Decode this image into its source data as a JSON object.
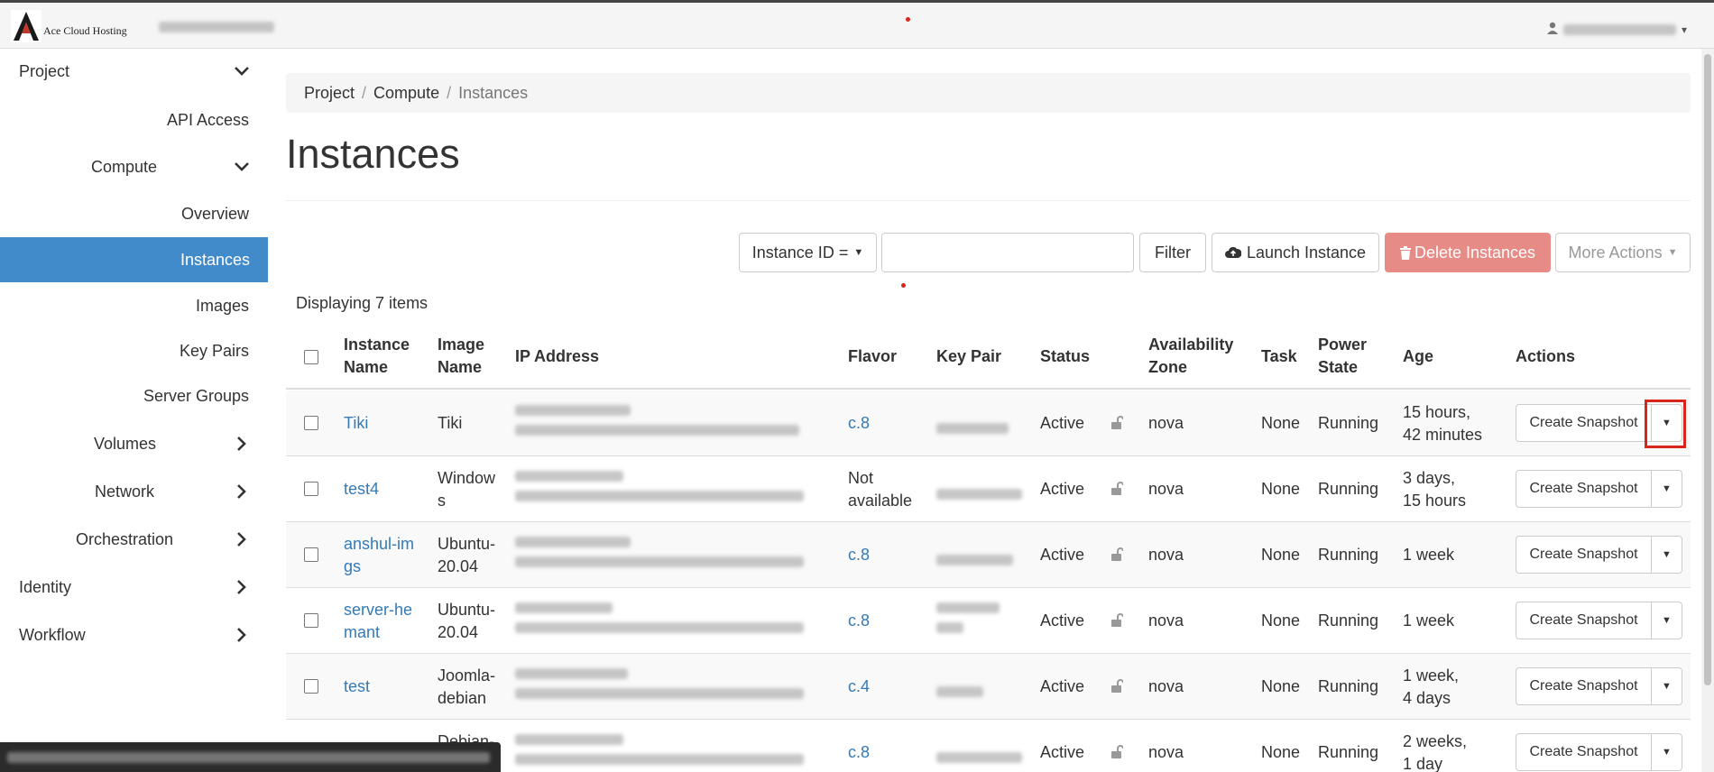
{
  "brand": {
    "name": "Ace Cloud Hosting"
  },
  "sidebar": {
    "items": [
      {
        "label": "Project",
        "chevron": "down"
      },
      {
        "label": "API Access"
      },
      {
        "label": "Compute",
        "chevron": "down"
      },
      {
        "label": "Overview"
      },
      {
        "label": "Instances",
        "active": true
      },
      {
        "label": "Images"
      },
      {
        "label": "Key Pairs"
      },
      {
        "label": "Server Groups"
      },
      {
        "label": "Volumes",
        "chevron": "right"
      },
      {
        "label": "Network",
        "chevron": "right"
      },
      {
        "label": "Orchestration",
        "chevron": "right"
      },
      {
        "label": "Identity",
        "chevron": "right"
      },
      {
        "label": "Workflow",
        "chevron": "right"
      }
    ]
  },
  "breadcrumb": {
    "items": [
      "Project",
      "Compute",
      "Instances"
    ]
  },
  "page": {
    "title": "Instances"
  },
  "toolbar": {
    "filter_field": "Instance ID =",
    "search_placeholder": "",
    "filter_label": "Filter",
    "launch_label": "Launch Instance",
    "delete_label": "Delete Instances",
    "more_label": "More Actions"
  },
  "table": {
    "count_text": "Displaying 7 items",
    "headers": {
      "name": [
        "Instance",
        "Name"
      ],
      "image": [
        "Image",
        "Name"
      ],
      "ip": "IP Address",
      "flavor": "Flavor",
      "keypair": "Key Pair",
      "status": "Status",
      "az": [
        "Availability",
        "Zone"
      ],
      "task": "Task",
      "power": [
        "Power",
        "State"
      ],
      "age": "Age",
      "actions": "Actions"
    },
    "rows": [
      {
        "name": [
          "Tiki"
        ],
        "image": [
          "Tiki"
        ],
        "flavor": [
          "c.8"
        ],
        "flavor_link": true,
        "status": "Active",
        "az": "nova",
        "task": "None",
        "power": "Running",
        "age": [
          "15 hours,",
          "42 minutes"
        ],
        "action": "Create Snapshot"
      },
      {
        "name": [
          "test4"
        ],
        "image": [
          "Window",
          "s"
        ],
        "flavor": [
          "Not",
          "available"
        ],
        "flavor_link": false,
        "status": "Active",
        "az": "nova",
        "task": "None",
        "power": "Running",
        "age": [
          "3 days,",
          "15 hours"
        ],
        "action": "Create Snapshot"
      },
      {
        "name": [
          "anshul-im",
          "gs"
        ],
        "image": [
          "Ubuntu-",
          "20.04"
        ],
        "flavor": [
          "c.8"
        ],
        "flavor_link": true,
        "status": "Active",
        "az": "nova",
        "task": "None",
        "power": "Running",
        "age": [
          "1 week"
        ],
        "action": "Create Snapshot"
      },
      {
        "name": [
          "server-he",
          "mant"
        ],
        "image": [
          "Ubuntu-",
          "20.04"
        ],
        "flavor": [
          "c.8"
        ],
        "flavor_link": true,
        "status": "Active",
        "az": "nova",
        "task": "None",
        "power": "Running",
        "age": [
          "1 week"
        ],
        "action": "Create Snapshot"
      },
      {
        "name": [
          "test"
        ],
        "image": [
          "Joomla-",
          "debian"
        ],
        "flavor": [
          "c.4"
        ],
        "flavor_link": true,
        "status": "Active",
        "az": "nova",
        "task": "None",
        "power": "Running",
        "age": [
          "1 week,",
          "4 days"
        ],
        "action": "Create Snapshot"
      },
      {
        "name": [],
        "image": [
          "Debian-"
        ],
        "flavor": [
          "c.8"
        ],
        "flavor_link": true,
        "status": "Active",
        "az": "nova",
        "task": "None",
        "power": "Running",
        "age": [
          "2 weeks,",
          "1 day"
        ],
        "action": "Create Snapshot"
      }
    ]
  },
  "icons": {
    "chevron_down": "chevron-down-icon",
    "chevron_right": "chevron-right-icon",
    "cloud_upload": "cloud-upload-icon",
    "trash": "trash-icon",
    "lock": "unlocked-icon",
    "user": "user-icon"
  },
  "colors": {
    "active_nav": "#428bca",
    "link": "#337ab7",
    "danger_button": "#e78b87",
    "highlight": "#d9261c"
  }
}
